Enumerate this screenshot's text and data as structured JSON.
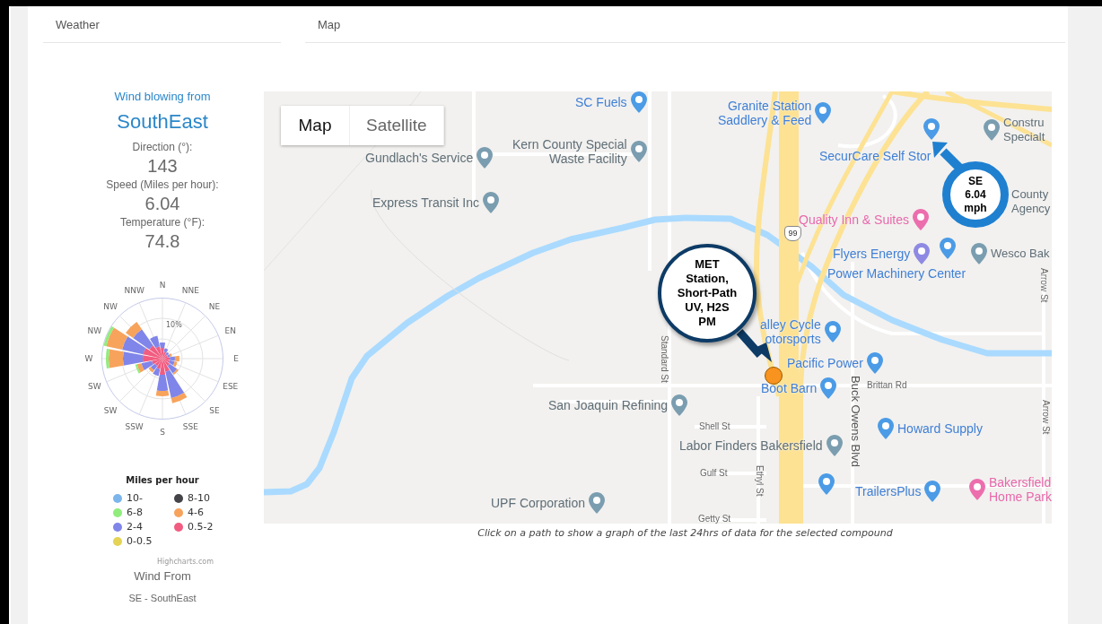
{
  "headers": [
    {
      "label": "Weather"
    },
    {
      "label": "Map"
    }
  ],
  "weather": {
    "heading": "Wind blowing from",
    "direction_name": "SouthEast",
    "fields": [
      {
        "label": "Direction (°):",
        "value": "143"
      },
      {
        "label": "Speed (Miles per hour):",
        "value": "6.04"
      },
      {
        "label": "Temperature (°F):",
        "value": "74.8"
      }
    ],
    "wind_rose": {
      "directions_east": [
        "N",
        "NNE",
        "NE",
        "EN",
        "E",
        "ESE",
        "SE",
        "SSE",
        "S"
      ],
      "directions_west": [
        "NNW",
        "NW",
        "NW",
        "W",
        "SW",
        "SW",
        "SSW"
      ],
      "ring_label": "10%",
      "legend_title": "Miles per hour",
      "legend": [
        {
          "label": "10-",
          "color": "#7cb5ec"
        },
        {
          "label": "8-10",
          "color": "#434348"
        },
        {
          "label": "6-8",
          "color": "#90ed7d"
        },
        {
          "label": "4-6",
          "color": "#f7a35c"
        },
        {
          "label": "2-4",
          "color": "#8085e9"
        },
        {
          "label": "0.5-2",
          "color": "#f15c80"
        },
        {
          "label": "0-0.5",
          "color": "#e4d354"
        }
      ],
      "credit": "Highcharts.com"
    },
    "wind_from": {
      "label": "Wind From",
      "value": "SE - SouthEast"
    }
  },
  "map": {
    "view_types": [
      {
        "label": "Map",
        "selected": true
      },
      {
        "label": "Satellite",
        "selected": false
      }
    ],
    "places": [
      {
        "label": "SC Fuels",
        "kind": "shop"
      },
      {
        "label": "Gundlach's Service",
        "kind": "place"
      },
      {
        "label": "Kern County Special\nWaste Facility",
        "kind": "place"
      },
      {
        "label": "Express Transit Inc",
        "kind": "place"
      },
      {
        "label": "Granite Station\nSaddlery & Feed",
        "kind": "shop"
      },
      {
        "label": "Constru\nSpecialt",
        "kind": "place"
      },
      {
        "label": "SecurCare Self Stor",
        "kind": "shop"
      },
      {
        "label": "County\nAgency",
        "kind": "place"
      },
      {
        "label": "Quality Inn & Suites",
        "kind": "lodging"
      },
      {
        "label": "Flyers Energy",
        "kind": "fuel"
      },
      {
        "label": "Wesco Bak",
        "kind": "place"
      },
      {
        "label": "Power Machinery Center",
        "kind": "shop"
      },
      {
        "label": "alley Cycle\notorsports",
        "kind": "shop"
      },
      {
        "label": "Pacific Power",
        "kind": "shop"
      },
      {
        "label": "Boot Barn",
        "kind": "shop"
      },
      {
        "label": "San Joaquin Refining",
        "kind": "place"
      },
      {
        "label": "Howard Supply",
        "kind": "shop"
      },
      {
        "label": "Labor Finders Bakersfield",
        "kind": "place"
      },
      {
        "label": "UPF Corporation",
        "kind": "place"
      },
      {
        "label": "TrailersPlus",
        "kind": "shop"
      },
      {
        "label": "Bakersfield\nHome Park",
        "kind": "lodging"
      }
    ],
    "streets": [
      {
        "label": "Standard St",
        "kind": "vertical"
      },
      {
        "label": "Shell St",
        "kind": "horizontal"
      },
      {
        "label": "Gulf St",
        "kind": "horizontal"
      },
      {
        "label": "Ethyl St",
        "kind": "vertical"
      },
      {
        "label": "Getty St",
        "kind": "horizontal"
      },
      {
        "label": "Buck Owens Blvd",
        "kind": "vertical"
      },
      {
        "label": "Brittan Rd",
        "kind": "horizontal"
      },
      {
        "label": "Arrow St",
        "kind": "vertical"
      },
      {
        "label": "Arrow St",
        "kind": "vertical"
      }
    ],
    "highway_shield": "99",
    "callouts": [
      {
        "kind": "station",
        "text": "MET\nStation,\nShort-Path\nUV, H2S\nPM"
      },
      {
        "kind": "wind",
        "text": "SE\n6.04\nmph"
      }
    ],
    "caption": "Click on a path to show a graph of the last 24hrs of data for the selected compound"
  }
}
